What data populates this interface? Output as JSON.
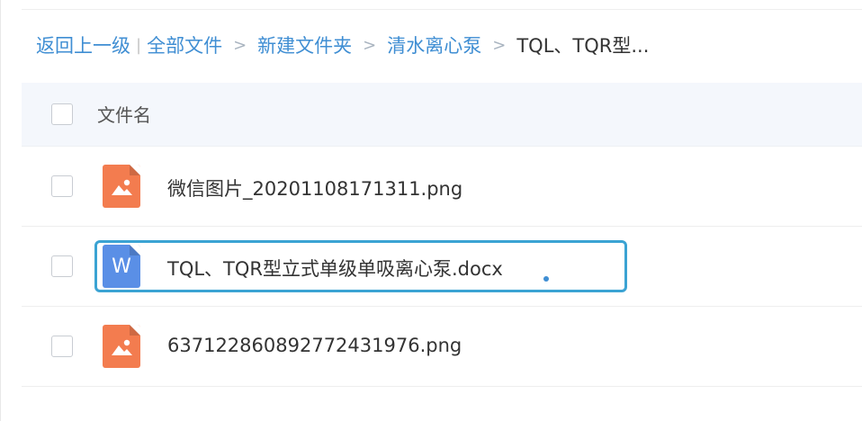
{
  "breadcrumb": {
    "back": "返回上一级",
    "pipe": "|",
    "all_files": "全部文件",
    "separator": ">",
    "path": [
      "新建文件夹",
      "清水离心泵"
    ],
    "current": "TQL、TQR型..."
  },
  "list": {
    "header_label": "文件名",
    "files": [
      {
        "name": "微信图片_20201108171311.png",
        "icon": "image-file-icon",
        "color": "#f37c4f"
      },
      {
        "name": "TQL、TQR型立式单级单吸离心泵.docx",
        "icon": "word-file-icon",
        "icon_letter": "W",
        "color": "#5a8fe6"
      },
      {
        "name": "637122860892772431976.png",
        "icon": "image-file-icon",
        "color": "#f37c4f"
      }
    ]
  },
  "colors": {
    "link": "#3f8ed3",
    "header_bg": "#f4f7fc",
    "focus_border": "#3ba3d3"
  }
}
